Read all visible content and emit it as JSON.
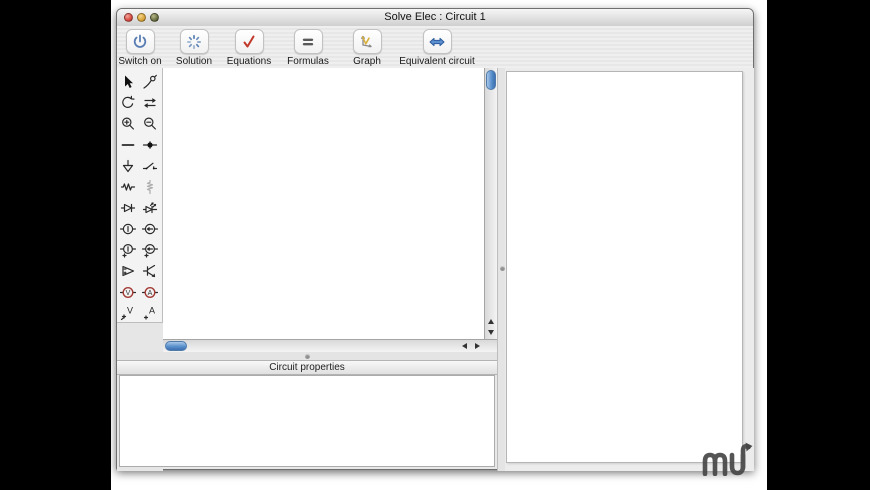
{
  "window": {
    "title": "Solve Elec : Circuit 1",
    "traffic_lights": [
      "close",
      "minimize",
      "zoom"
    ]
  },
  "toolbar": {
    "items": [
      {
        "label": "Switch on",
        "icon": "power-icon"
      },
      {
        "label": "Solution",
        "icon": "spinner-burst-icon"
      },
      {
        "label": "Equations",
        "icon": "red-checkmark-icon"
      },
      {
        "label": "Formulas",
        "icon": "equals-icon"
      },
      {
        "label": "Graph",
        "icon": "graph-curve-icon"
      },
      {
        "label": "Equivalent circuit",
        "icon": "double-arrow-icon"
      }
    ]
  },
  "palette": {
    "tools": [
      "select-arrow",
      "bend-wire-tool",
      "rotate-tool",
      "reverse-tool",
      "zoom-in-tool",
      "zoom-out-tool",
      "wire-tool",
      "node-tool",
      "ground-tool",
      "switch-tool",
      "resistor-tool",
      "rheostat-tool",
      "diode-tool",
      "led-tool",
      "voltage-source-tool",
      "current-source-tool",
      "polarized-voltage-source-tool",
      "polarized-current-source-tool",
      "opamp-tool",
      "transistor-tool",
      "voltmeter-tool",
      "ammeter-tool",
      "voltage-probe-tool",
      "current-probe-tool"
    ],
    "letters": {
      "voltmeter": "V",
      "ammeter": "A",
      "voltage_probe": "V",
      "current_probe": "A"
    }
  },
  "properties_panel": {
    "title": "Circuit properties"
  },
  "colors": {
    "accent_blue": "#4a7fc1",
    "check_red": "#c0392b",
    "graph_yellow": "#d9b03c",
    "traffic_red": "#d94c43",
    "traffic_yellow": "#d9a43b",
    "traffic_green": "#6b7246",
    "scroll_thumb_blue": "#5a91cc"
  },
  "watermark": {
    "name": "macupdate-mu-logo"
  }
}
